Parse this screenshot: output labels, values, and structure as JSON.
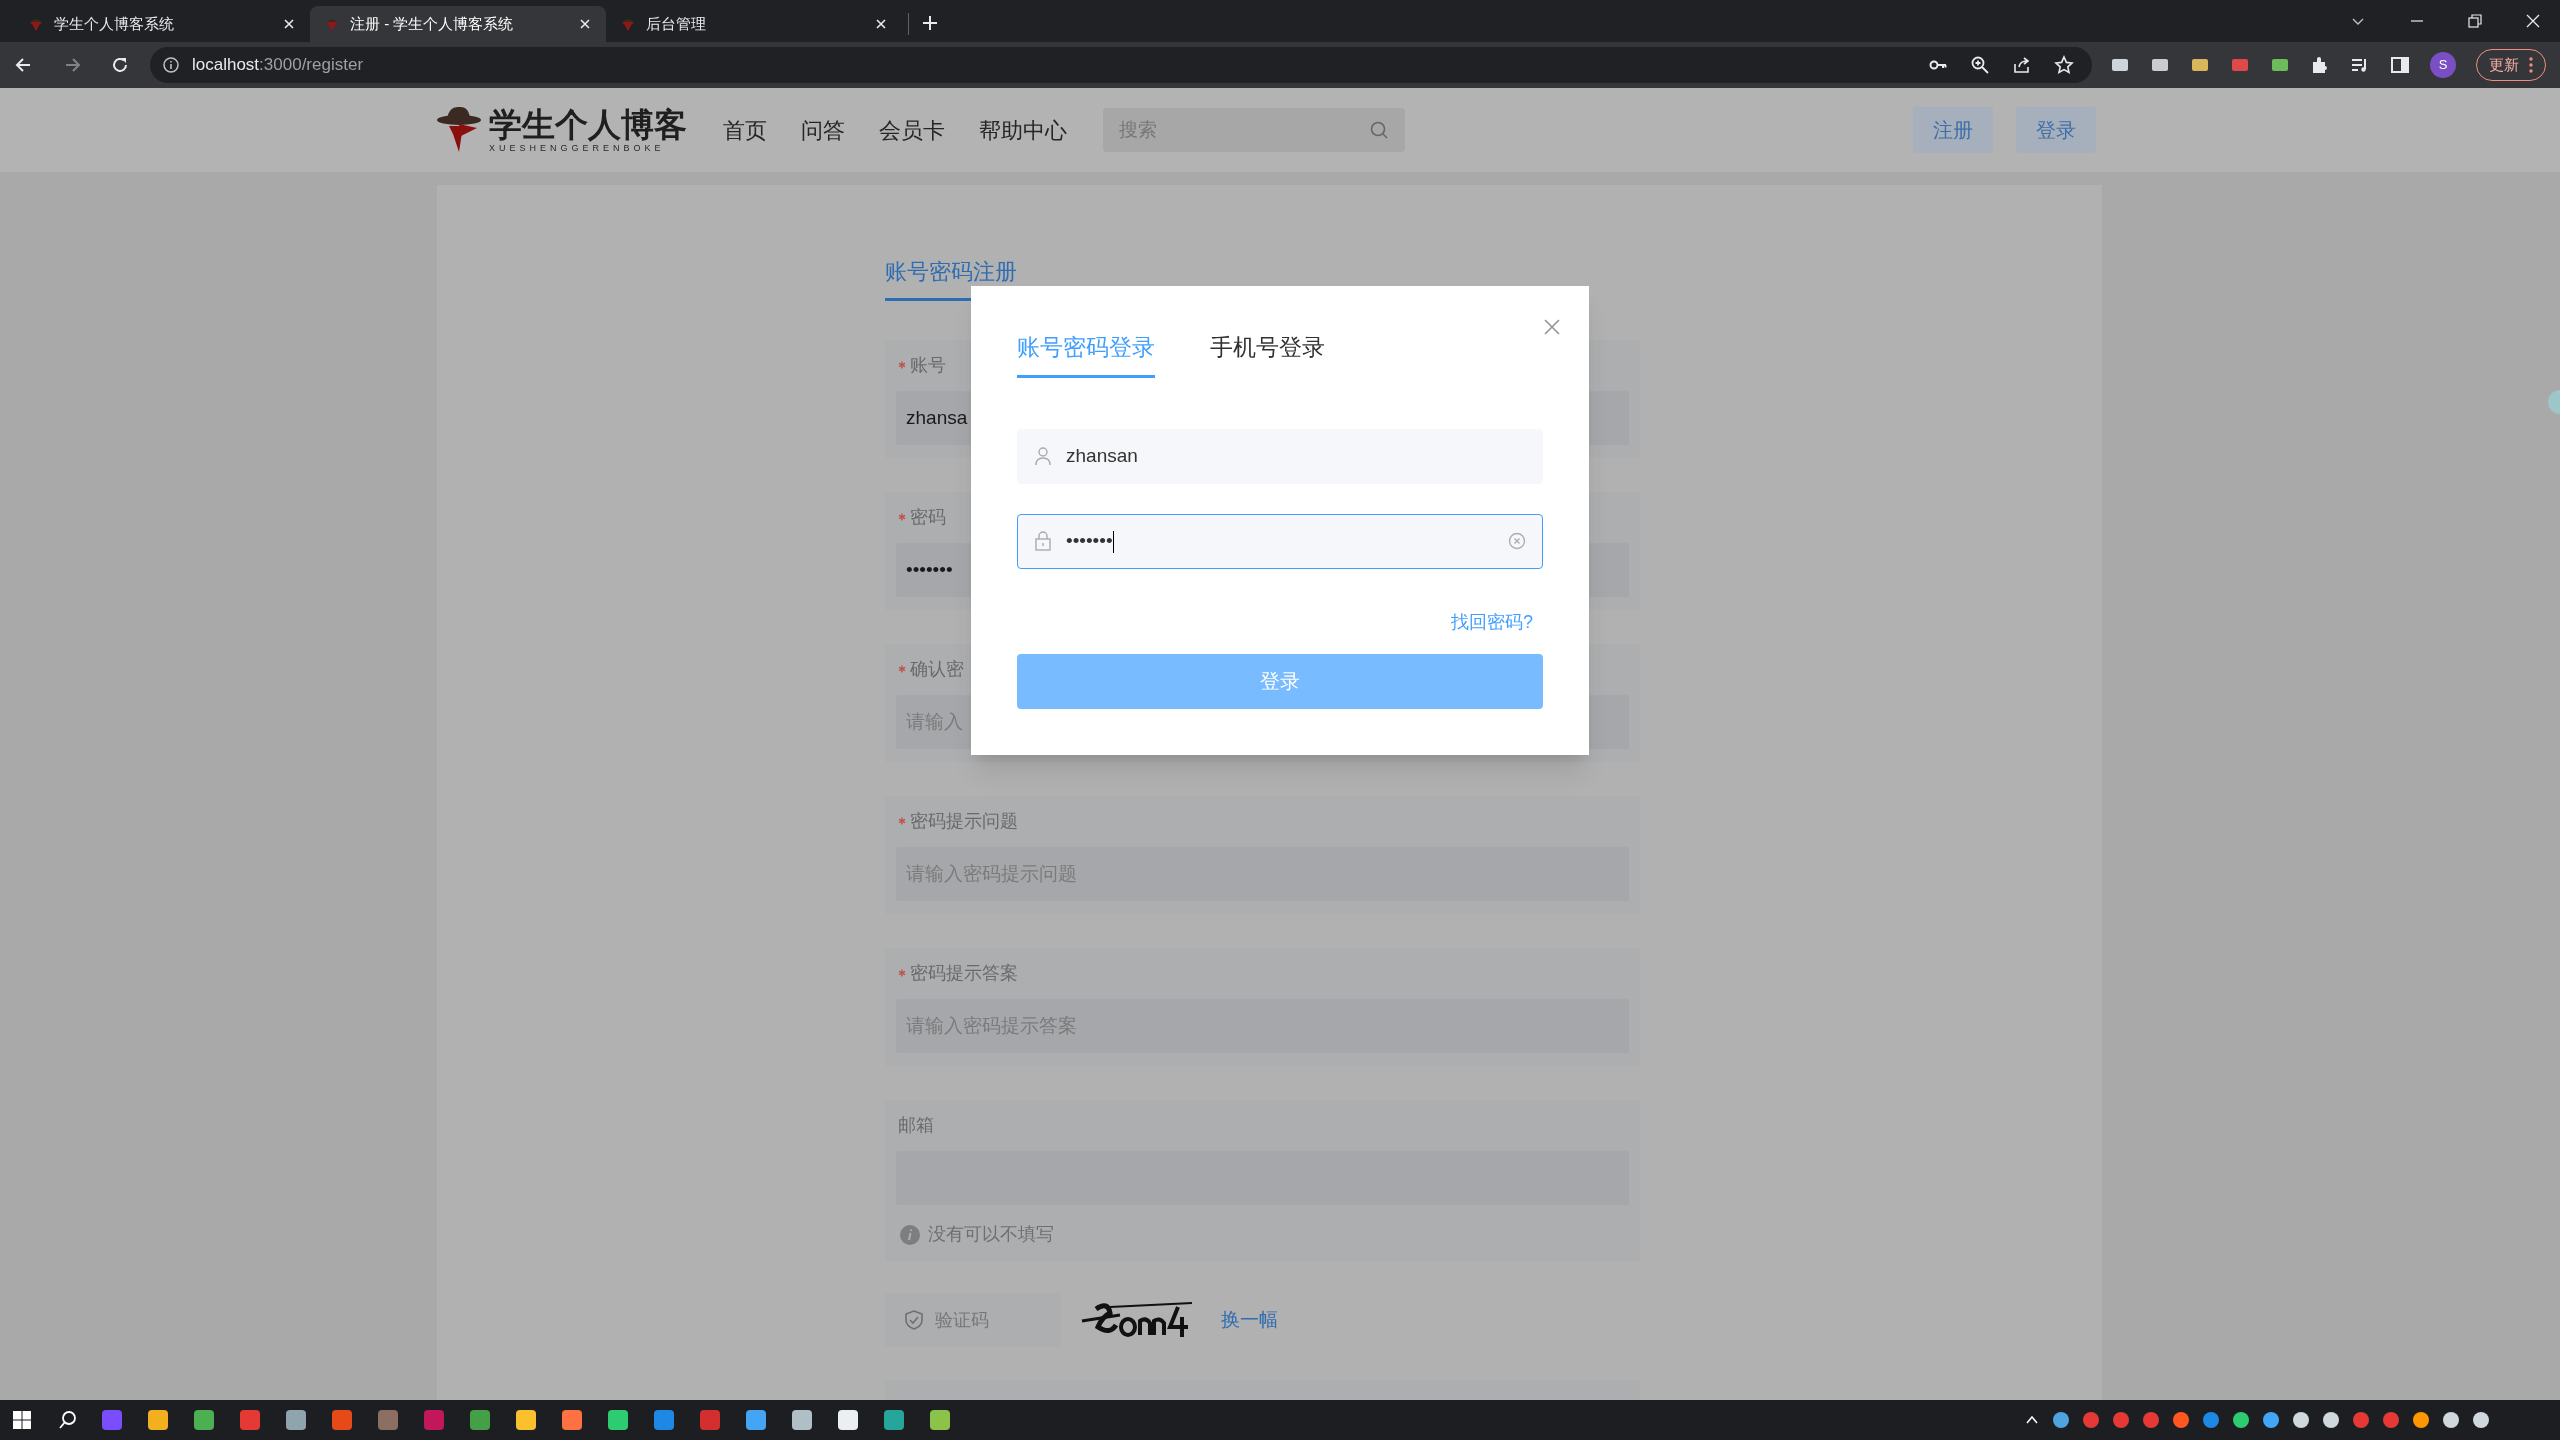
{
  "browser": {
    "tabs": [
      {
        "title": "学生个人博客系统",
        "selected": false
      },
      {
        "title": "注册 - 学生个人博客系统",
        "selected": true
      },
      {
        "title": "后台管理",
        "selected": false
      }
    ],
    "url_host": "localhost",
    "url_path": ":3000/register",
    "profile": "S",
    "update_button": "更新"
  },
  "header": {
    "logo_text": "学生个人博客",
    "logo_subtitle": "XUESHENGGERENBOKE",
    "nav": [
      "首页",
      "问答",
      "会员卡",
      "帮助中心"
    ],
    "search": {
      "placeholder": "搜索"
    },
    "buttons": [
      "注册",
      "登录"
    ]
  },
  "register_form": {
    "title": "账号密码注册",
    "fields": [
      {
        "label": "账号",
        "required": true,
        "value": "zhansa"
      },
      {
        "label": "密码",
        "required": true,
        "value": "•••••••"
      },
      {
        "label": "确认密",
        "required": true,
        "placeholder": "请输入"
      },
      {
        "label": "密码提示问题",
        "required": true,
        "placeholder": "请输入密码提示问题"
      },
      {
        "label": "密码提示答案",
        "required": true,
        "placeholder": "请输入密码提示答案"
      },
      {
        "label": "邮箱",
        "required": false,
        "hint": "没有可以不填写"
      }
    ],
    "captcha": {
      "placeholder": "验证码",
      "refresh_link": "换一幅"
    }
  },
  "login_dialog": {
    "tabs": [
      {
        "label": "账号密码登录",
        "selected": true
      },
      {
        "label": "手机号登录",
        "selected": false
      }
    ],
    "username": {
      "value": "zhansan",
      "focused": false
    },
    "password": {
      "value": "•••••••",
      "focused": true
    },
    "forgot_link": "找回密码?",
    "submit": "登录"
  }
}
